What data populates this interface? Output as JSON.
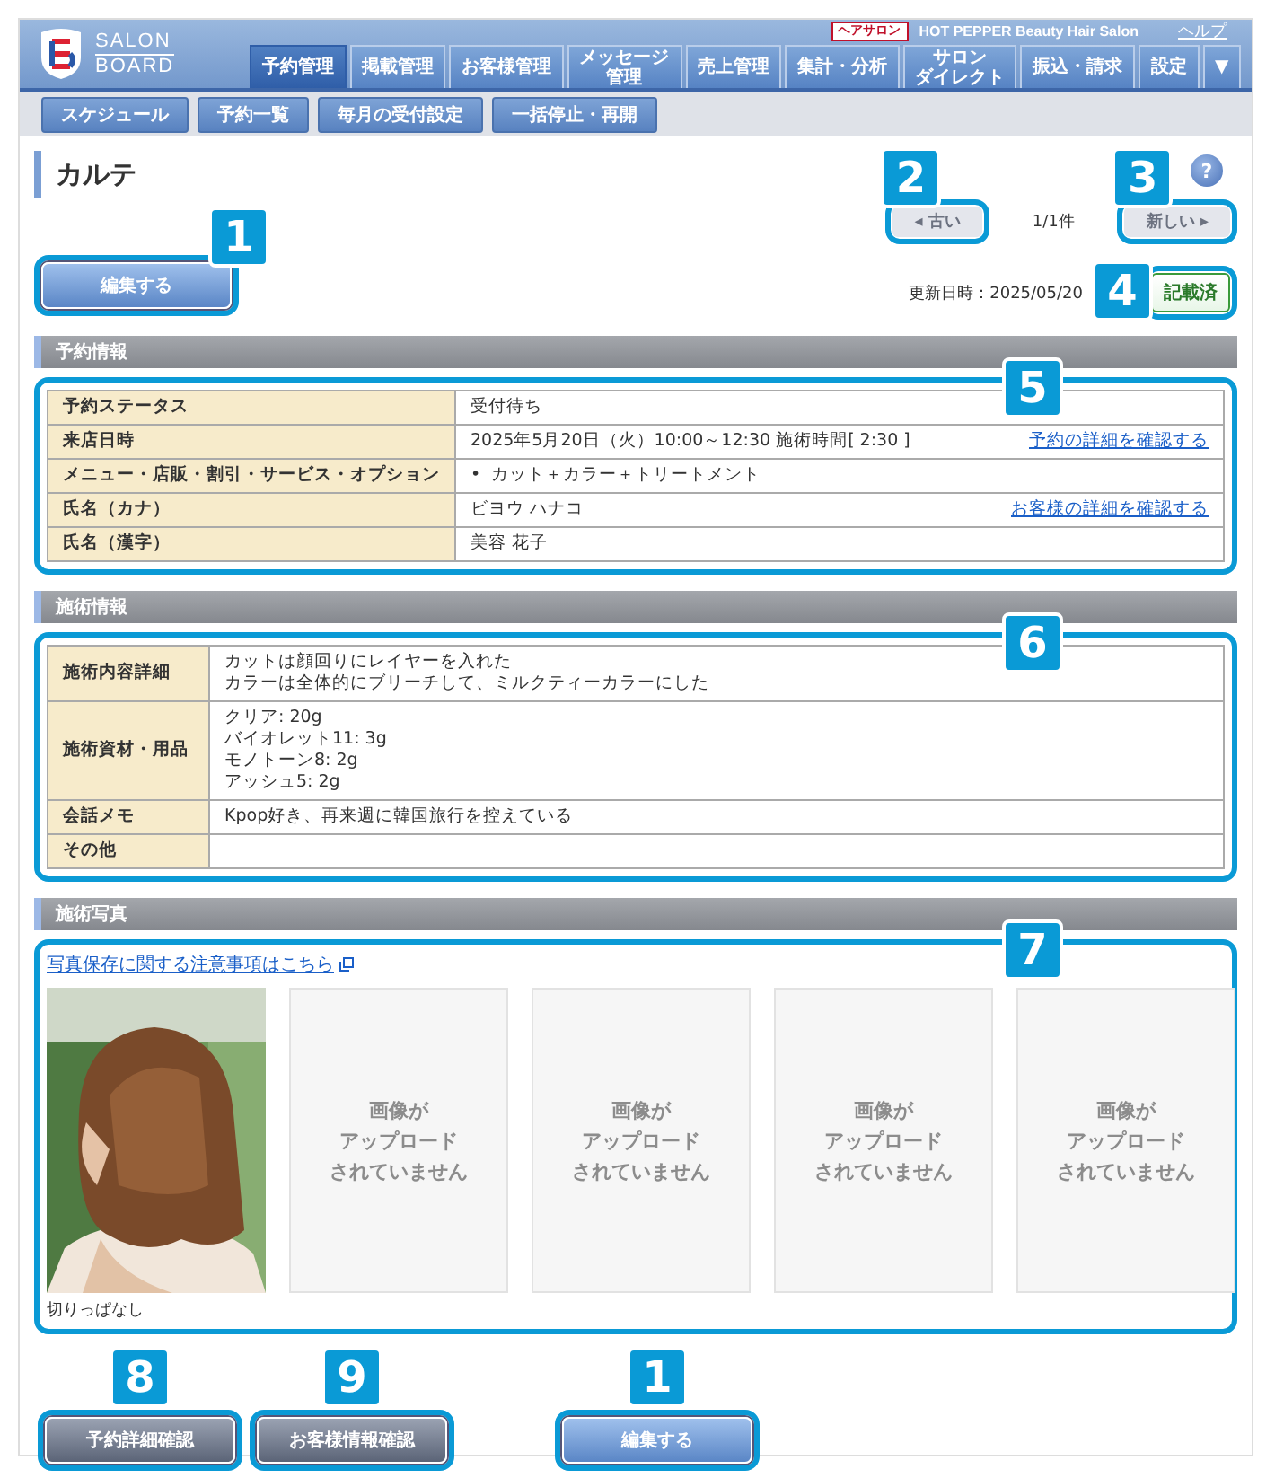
{
  "header": {
    "logo": [
      "SALON",
      "BOARD"
    ],
    "badge": "ヘアサロン",
    "brand": "HOT PEPPER Beauty Hair Salon",
    "help_link": "ヘルプ"
  },
  "tabs": [
    {
      "lines": [
        "予約管理"
      ],
      "selected": true
    },
    {
      "lines": [
        "掲載管理"
      ],
      "selected": false
    },
    {
      "lines": [
        "お客様管理"
      ],
      "selected": false
    },
    {
      "lines": [
        "メッセージ",
        "管理"
      ],
      "selected": false
    },
    {
      "lines": [
        "売上管理"
      ],
      "selected": false
    },
    {
      "lines": [
        "集計・分析"
      ],
      "selected": false
    },
    {
      "lines": [
        "サロン",
        "ダイレクト"
      ],
      "selected": false
    },
    {
      "lines": [
        "振込・請求"
      ],
      "selected": false
    },
    {
      "lines": [
        "設定"
      ],
      "selected": false
    },
    {
      "lines": [
        "▼"
      ],
      "selected": false
    }
  ],
  "subnav": [
    "スケジュール",
    "予約一覧",
    "毎月の受付設定",
    "一括停止・再開"
  ],
  "page": {
    "title": "カルテ",
    "help": "?"
  },
  "toolbar": {
    "edit_button": {
      "label": "編集する",
      "callout": "1"
    },
    "pager": {
      "prev": {
        "icon": "◂",
        "label": "古い",
        "disabled": true,
        "callout": "2"
      },
      "count": "1/1件",
      "next": {
        "label": "新しい",
        "icon": "▸",
        "disabled": true,
        "callout": "3"
      }
    },
    "updated": "更新日時：2025/05/20",
    "status_badge": {
      "label": "記載済",
      "callout": "4"
    }
  },
  "sections": [
    {
      "title": "予約情報",
      "callout": "5",
      "rows": [
        {
          "label": "予約ステータス",
          "kind": "text",
          "lines": [
            "受付待ち"
          ]
        },
        {
          "label": "来店日時",
          "kind": "text",
          "lines": [
            "2025年5月20日（火）10:00～12:30 施術時間[ 2:30 ]"
          ],
          "link": "予約の詳細を確認する"
        },
        {
          "label": "メニュー・店販・割引・サービス・オプション",
          "kind": "list",
          "marker": "•",
          "lines": [
            "カット＋カラー＋トリートメント"
          ]
        },
        {
          "label": "氏名（カナ）",
          "kind": "text",
          "lines": [
            "ビヨウ ハナコ"
          ],
          "link": "お客様の詳細を確認する"
        },
        {
          "label": "氏名（漢字）",
          "kind": "text",
          "lines": [
            "美容 花子"
          ]
        }
      ]
    },
    {
      "title": "施術情報",
      "callout": "6",
      "rows": [
        {
          "label": "施術内容詳細",
          "kind": "text",
          "lines": [
            "カットは顔回りにレイヤーを入れた",
            "カラーは全体的にブリーチして、ミルクティーカラーにした"
          ]
        },
        {
          "label": "施術資材・用品",
          "kind": "text",
          "lines": [
            "クリア: 20g",
            "バイオレット11: 3g",
            "モノトーン8: 2g",
            "アッシュ5: 2g"
          ]
        },
        {
          "label": "会話メモ",
          "kind": "text",
          "lines": [
            "Kpop好き、再来週に韓国旅行を控えている"
          ]
        },
        {
          "label": "その他",
          "kind": "text",
          "lines": []
        }
      ]
    }
  ],
  "photos": {
    "title": "施術写真",
    "callout": "7",
    "link": "写真保存に関する注意事項はこちら",
    "slots": [
      {
        "kind": "picture",
        "caption": "切りっぱなし"
      },
      {
        "kind": "empty",
        "lines": [
          "画像が",
          "アップロード",
          "されていません"
        ]
      },
      {
        "kind": "empty",
        "lines": [
          "画像が",
          "アップロード",
          "されていません"
        ]
      },
      {
        "kind": "empty",
        "lines": [
          "画像が",
          "アップロード",
          "されていません"
        ]
      },
      {
        "kind": "empty",
        "lines": [
          "画像が",
          "アップロード",
          "されていません"
        ]
      }
    ]
  },
  "bottom_buttons": [
    {
      "label": "予約詳細確認",
      "kind": "secondary",
      "callout": "8"
    },
    {
      "label": "お客様情報確認",
      "kind": "secondary",
      "callout": "9"
    },
    {
      "label": "編集する",
      "kind": "primary",
      "callout": "1"
    }
  ]
}
